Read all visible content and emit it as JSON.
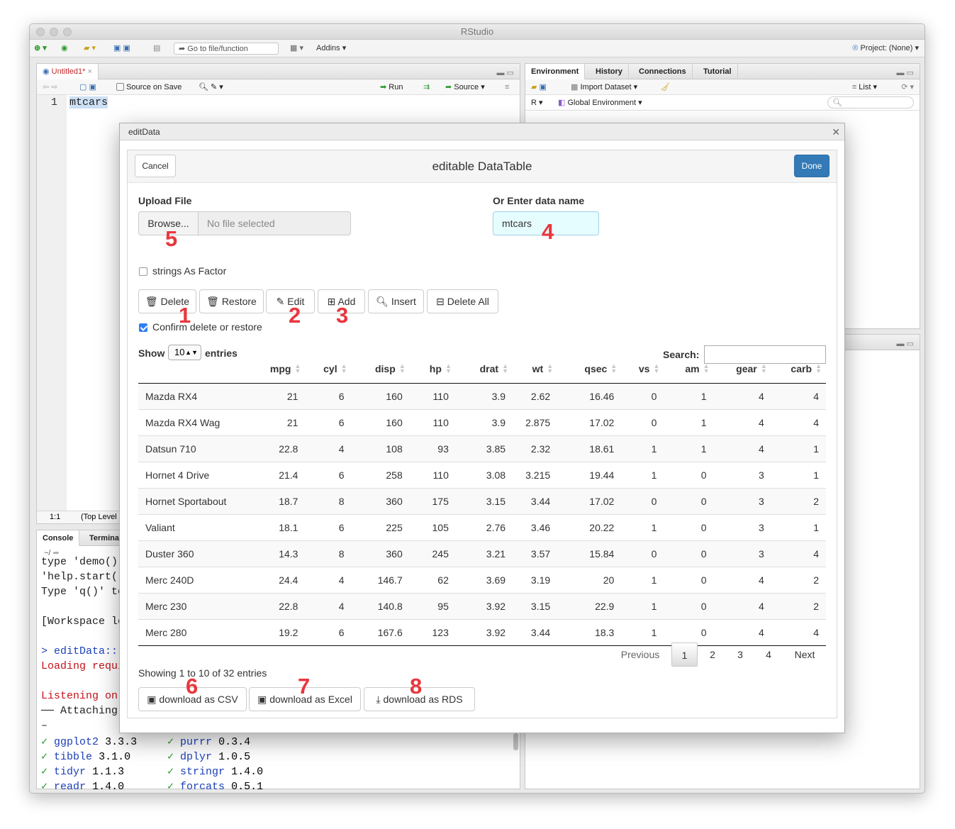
{
  "app": {
    "title": "RStudio"
  },
  "toolbar": {
    "goto_placeholder": "Go to file/function",
    "addins": "Addins",
    "project": "Project: (None)"
  },
  "editor": {
    "tab": "Untitled1*",
    "source_on_save": "Source on Save",
    "run": "Run",
    "source": "Source",
    "line_number": "1",
    "code": "mtcars",
    "status_pos": "1:1",
    "status_scope": "(Top Level"
  },
  "env": {
    "tabs": [
      "Environment",
      "History",
      "Connections",
      "Tutorial"
    ],
    "import": "Import Dataset",
    "list": "List",
    "r": "R",
    "global_env": "Global Environment"
  },
  "console": {
    "tabs": [
      "Console",
      "Termina"
    ],
    "path": "~/",
    "lines": [
      "type 'demo()'",
      "'help.start()",
      "Type 'q()' to",
      "",
      "[Workspace lo",
      "",
      "> editData:::",
      "Loading requi",
      "",
      "Listening on",
      "── Attaching",
      "–"
    ],
    "packages": [
      {
        "name": "ggplot2",
        "ver": "3.3.3"
      },
      {
        "name": "tibble",
        "ver": "3.1.0"
      },
      {
        "name": "tidyr",
        "ver": "1.1.3"
      },
      {
        "name": "readr",
        "ver": "1.4.0"
      }
    ],
    "packages2": [
      {
        "name": "purrr",
        "ver": "0.3.4"
      },
      {
        "name": "dplyr",
        "ver": "1.0.5"
      },
      {
        "name": "stringr",
        "ver": "1.4.0"
      },
      {
        "name": "forcats",
        "ver": "0.5.1"
      }
    ]
  },
  "modal": {
    "window_title": "editData",
    "title": "editable DataTable",
    "cancel": "Cancel",
    "done": "Done",
    "upload_label": "Upload File",
    "browse": "Browse...",
    "no_file": "No file selected",
    "data_name_label": "Or Enter data name",
    "data_name_value": "mtcars",
    "strings_as_factor": "strings As Factor",
    "confirm": "Confirm delete or restore",
    "buttons": {
      "delete": "Delete",
      "restore": "Restore",
      "edit": "Edit",
      "add": "Add",
      "insert": "Insert",
      "delete_all": "Delete All"
    },
    "show": "Show",
    "entries_sel": "10",
    "entries": "entries",
    "search": "Search:",
    "columns": [
      "",
      "mpg",
      "cyl",
      "disp",
      "hp",
      "drat",
      "wt",
      "qsec",
      "vs",
      "am",
      "gear",
      "carb"
    ],
    "rows": [
      [
        "Mazda RX4",
        "21",
        "6",
        "160",
        "110",
        "3.9",
        "2.62",
        "16.46",
        "0",
        "1",
        "4",
        "4"
      ],
      [
        "Mazda RX4 Wag",
        "21",
        "6",
        "160",
        "110",
        "3.9",
        "2.875",
        "17.02",
        "0",
        "1",
        "4",
        "4"
      ],
      [
        "Datsun 710",
        "22.8",
        "4",
        "108",
        "93",
        "3.85",
        "2.32",
        "18.61",
        "1",
        "1",
        "4",
        "1"
      ],
      [
        "Hornet 4 Drive",
        "21.4",
        "6",
        "258",
        "110",
        "3.08",
        "3.215",
        "19.44",
        "1",
        "0",
        "3",
        "1"
      ],
      [
        "Hornet Sportabout",
        "18.7",
        "8",
        "360",
        "175",
        "3.15",
        "3.44",
        "17.02",
        "0",
        "0",
        "3",
        "2"
      ],
      [
        "Valiant",
        "18.1",
        "6",
        "225",
        "105",
        "2.76",
        "3.46",
        "20.22",
        "1",
        "0",
        "3",
        "1"
      ],
      [
        "Duster 360",
        "14.3",
        "8",
        "360",
        "245",
        "3.21",
        "3.57",
        "15.84",
        "0",
        "0",
        "3",
        "4"
      ],
      [
        "Merc 240D",
        "24.4",
        "4",
        "146.7",
        "62",
        "3.69",
        "3.19",
        "20",
        "1",
        "0",
        "4",
        "2"
      ],
      [
        "Merc 230",
        "22.8",
        "4",
        "140.8",
        "95",
        "3.92",
        "3.15",
        "22.9",
        "1",
        "0",
        "4",
        "2"
      ],
      [
        "Merc 280",
        "19.2",
        "6",
        "167.6",
        "123",
        "3.92",
        "3.44",
        "18.3",
        "1",
        "0",
        "4",
        "4"
      ]
    ],
    "showing": "Showing 1 to 10 of 32 entries",
    "pagination": {
      "previous": "Previous",
      "pages": [
        "1",
        "2",
        "3",
        "4"
      ],
      "next": "Next"
    },
    "downloads": {
      "csv": "download as CSV",
      "excel": "download as Excel",
      "rds": "download as RDS"
    },
    "markers": [
      "1",
      "2",
      "3",
      "4",
      "5",
      "6",
      "7",
      "8"
    ]
  }
}
